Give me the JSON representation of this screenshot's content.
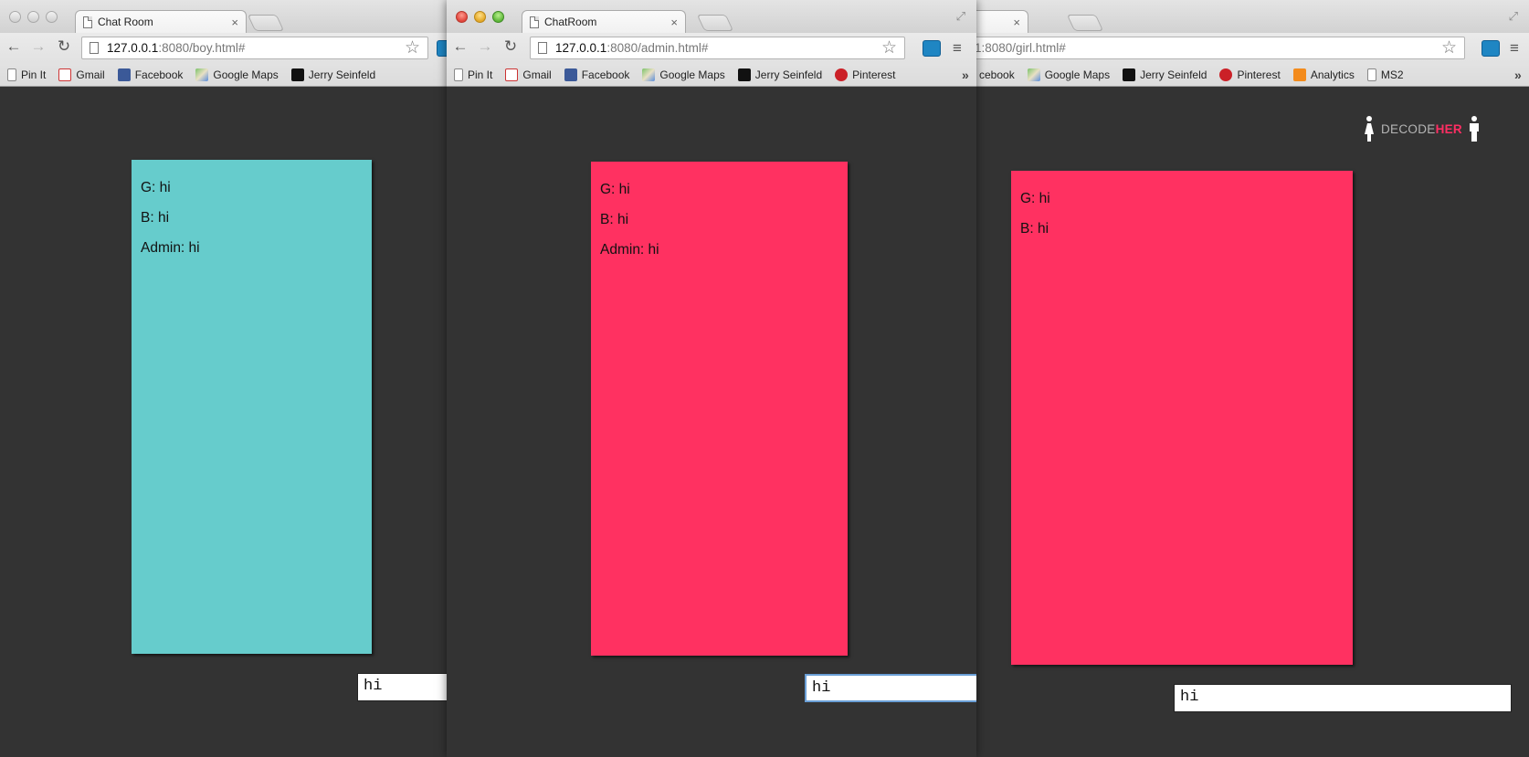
{
  "colors": {
    "boy_chat_bg": "#66cccc",
    "pink_chat_bg": "#ff3161",
    "page_bg": "#333333",
    "logo_accent": "#ff2e63"
  },
  "boy": {
    "tab_title": "Chat Room",
    "url_host": "127.0.0.1",
    "url_rest": ":8080/boy.html#",
    "bookmarks": [
      "Pin It",
      "Gmail",
      "Facebook",
      "Google Maps",
      "Jerry Seinfeld"
    ],
    "messages": [
      "G: hi",
      "B: hi",
      "Admin: hi"
    ],
    "input_value": "hi"
  },
  "admin": {
    "tab_title": "ChatRoom",
    "url_host": "127.0.0.1",
    "url_rest": ":8080/admin.html#",
    "bookmarks": [
      "Pin It",
      "Gmail",
      "Facebook",
      "Google Maps",
      "Jerry Seinfeld",
      "Pinterest"
    ],
    "overflow_chevron": "»",
    "messages": [
      "G: hi",
      "B: hi",
      "Admin: hi"
    ],
    "input_value": "hi"
  },
  "girl": {
    "url_partial": "1:8080/girl.html#",
    "bookmark_partial": "cebook",
    "bookmarks": [
      "Google Maps",
      "Jerry Seinfeld",
      "Pinterest",
      "Analytics",
      "MS2"
    ],
    "overflow_chevron": "»",
    "messages": [
      "G: hi",
      "B: hi"
    ],
    "input_value": "hi",
    "logo_left": "DECODE",
    "logo_right": "HER"
  },
  "icons": {
    "close": "×",
    "back": "←",
    "forward": "→",
    "reload": "↻",
    "star": "☆",
    "menu": "≡",
    "restore": "⤢"
  }
}
